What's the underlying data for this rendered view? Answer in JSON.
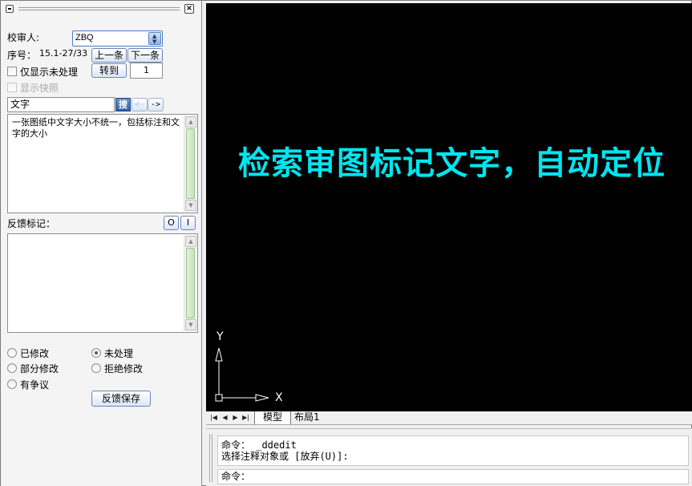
{
  "panel": {
    "reviewer_label": "校审人:",
    "reviewer_value": "ZBQ",
    "seq_label": "序号：",
    "seq_value": "15.1-27/33",
    "prev_label": "上一条",
    "next_label": "下一条",
    "goto_label": "转到",
    "goto_value": "1",
    "only_unprocessed_label": "仅显示未处理",
    "show_snapshot_label": "显示快照",
    "search_value": "文字",
    "search_button_label": "搜",
    "nav_back_label": "<-",
    "nav_forward_label": "->",
    "comment_text": "一张图纸中文字大小不统一，包括标注和文字的大小",
    "feedback_label": "反馈标记：",
    "mark_o_label": "O",
    "mark_i_label": "I",
    "feedback_text": "",
    "status_options": [
      "已修改",
      "未处理",
      "部分修改",
      "拒绝修改",
      "有争议"
    ],
    "selected_status": "未处理",
    "save_label": "反馈保存"
  },
  "canvas": {
    "headline": "检索审图标记文字，自动定位",
    "headline_color": "#00e5ef",
    "background": "#000000",
    "axis_y_label": "Y",
    "axis_x_label": "X"
  },
  "tabs": {
    "items": [
      "模型",
      "布局1"
    ],
    "active": "模型"
  },
  "command": {
    "history": [
      "命令： _ddedit",
      "选择注释对象或 [放弃(U)]:"
    ],
    "prompt": "命令："
  }
}
